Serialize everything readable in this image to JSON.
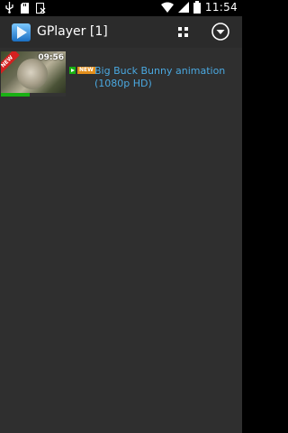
{
  "status_bar": {
    "time": "11:54",
    "left_icons": [
      "usb-icon",
      "sd-card-icon",
      "image-icon"
    ],
    "right_icons": [
      "wifi-icon",
      "signal-icon",
      "battery-icon"
    ]
  },
  "app_bar": {
    "title": "GPlayer [1]",
    "logo_icon": "gplayer-logo-icon",
    "grid_view_icon": "grid-view-icon",
    "overflow_menu_icon": "dropdown-menu-icon"
  },
  "videos": [
    {
      "title": "Big Buck Bunny animation (1080p HD)",
      "duration": "09:56",
      "ribbon": "NEW",
      "badge_new": "NEW",
      "progress": 0.45
    }
  ],
  "colors": {
    "background": "#2f2f2f",
    "app_bar": "#2b2b2b",
    "title_link": "#4aa8e0",
    "progress": "#19b014",
    "new_badge": "#e38f1c"
  }
}
